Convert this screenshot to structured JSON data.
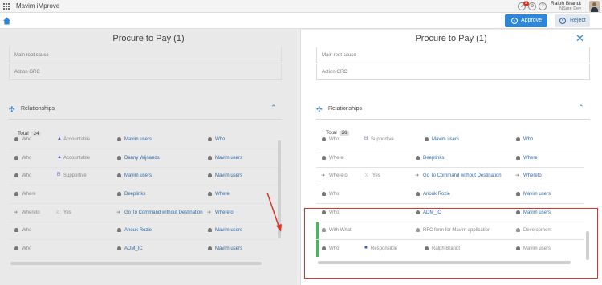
{
  "app": {
    "title": "Mavim iMprove"
  },
  "user": {
    "name": "Ralph Brandt",
    "org": "NSure Dev"
  },
  "header": {
    "notification_count": "2",
    "approve_label": "Approve",
    "reject_label": "Reject"
  },
  "left_panel": {
    "title": "Procure to Pay (1)",
    "fields": [
      "Main root cause",
      "Action GRC"
    ],
    "relationships_label": "Relationships",
    "total_label": "Total",
    "total_count": "24",
    "rows": [
      {
        "type": "Who",
        "role": "Accountable",
        "name": "Mavim users",
        "category": "Who"
      },
      {
        "type": "Who",
        "role": "Accountable",
        "name": "Danny Wijnands",
        "category": "Mavim users"
      },
      {
        "type": "Who",
        "role": "Supportive",
        "name": "Mavim users",
        "category": "Mavim users"
      },
      {
        "type": "Where",
        "role": "",
        "name": "Deeplinks",
        "category": "Where"
      },
      {
        "type": "Whereto",
        "role": "Yes",
        "name": "Go To Command without Destination",
        "category": "Whereto"
      },
      {
        "type": "Who",
        "role": "",
        "name": "Anouk Rozie",
        "category": "Mavim users"
      },
      {
        "type": "Who",
        "role": "",
        "name": "ADM_IC",
        "category": "Mavim users"
      }
    ]
  },
  "right_panel": {
    "title": "Procure to Pay (1)",
    "fields": [
      "Main root cause",
      "Action GRC"
    ],
    "relationships_label": "Relationships",
    "total_label": "Total",
    "total_count": "26",
    "rows": [
      {
        "type": "Who",
        "role": "Supportive",
        "name": "Mavim users",
        "category": "Who"
      },
      {
        "type": "Where",
        "role": "",
        "name": "Deeplinks",
        "category": "Where"
      },
      {
        "type": "Whereto",
        "role": "Yes",
        "name": "Go To Command without Destination",
        "category": "Whereto"
      },
      {
        "type": "Who",
        "role": "",
        "name": "Anouk Rozie",
        "category": "Mavim users"
      },
      {
        "type": "Who",
        "role": "",
        "name": "ADM_IC",
        "category": "Mavim users"
      },
      {
        "type": "With What",
        "role": "",
        "name": "RFC form for Mavim application",
        "category": "Development"
      },
      {
        "type": "Who",
        "role": "Responsible",
        "name": "Ralph Brandt",
        "category": "Mavim users"
      }
    ]
  },
  "colors": {
    "accent": "#2f86d6",
    "highlight": "#d9342b",
    "new_row": "#3fbd5a"
  }
}
